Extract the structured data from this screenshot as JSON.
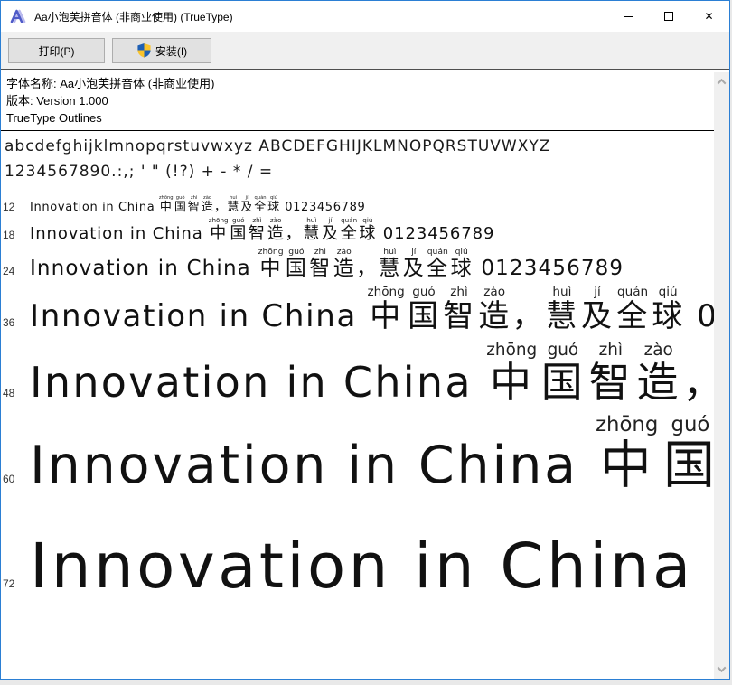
{
  "window": {
    "title": "Aa小泡芙拼音体 (非商业使用) (TrueType)",
    "close_glyph": "✕"
  },
  "toolbar": {
    "print_button": "打印(P)",
    "install_button": "安装(I)"
  },
  "font_info": {
    "name": "字体名称: Aa小泡芙拼音体 (非商业使用)",
    "version": "版本: Version 1.000",
    "outlines": "TrueType Outlines"
  },
  "glyph_samples": {
    "letters": "abcdefghijklmnopqrstuvwxyz ABCDEFGHIJKLMNOPQRSTUVWXYZ",
    "numerals": "1234567890.:,; ' \" (!?) + - * / ="
  },
  "preview": {
    "latin_text": "Innovation in China ",
    "chinese": [
      {
        "char": "中",
        "pinyin": "zhōng"
      },
      {
        "char": "国",
        "pinyin": "guó"
      },
      {
        "char": "智",
        "pinyin": "zhì"
      },
      {
        "char": "造",
        "pinyin": "zào"
      },
      {
        "char": "，",
        "pinyin": ""
      },
      {
        "char": "慧",
        "pinyin": "huì"
      },
      {
        "char": "及",
        "pinyin": "jí"
      },
      {
        "char": "全",
        "pinyin": "quán"
      },
      {
        "char": "球",
        "pinyin": "qiú"
      }
    ],
    "trailing_text": " 0123456789",
    "sizes": [
      12,
      18,
      24,
      36,
      48,
      60,
      72
    ]
  },
  "colors": {
    "window_border": "#2b7fd4",
    "toolbar_bg": "#f0f0f0",
    "button_bg": "#e1e1e1",
    "button_border": "#adadad",
    "separator_dark": "#4f4f4f",
    "shield_blue": "#1e5fb4",
    "shield_yellow": "#f9c32b",
    "text": "#000000"
  }
}
